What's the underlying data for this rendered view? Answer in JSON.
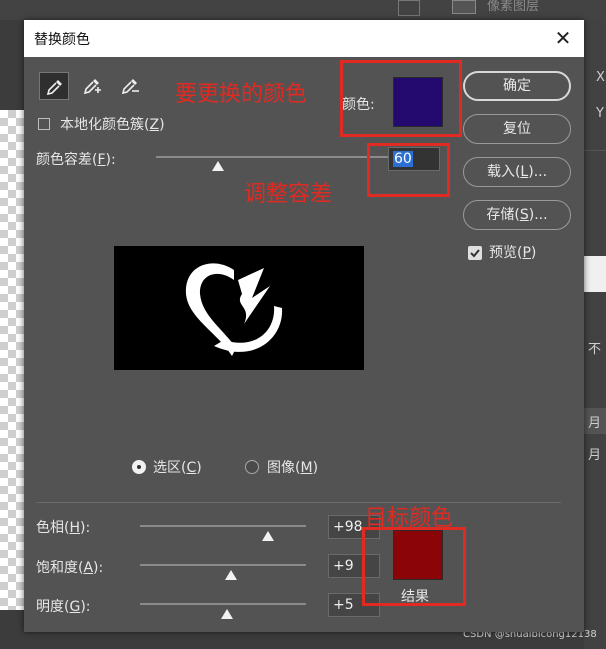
{
  "background": {
    "layer_label": "像素图层",
    "right_x": "X",
    "right_y": "Y",
    "right_items": [
      "不",
      "月",
      "月"
    ],
    "watermark": "CSDN @shuaibicong12138"
  },
  "dialog": {
    "title": "替换颜色",
    "close_glyph": "✕",
    "eyedropper_tools": [
      {
        "name": "eyedropper-icon",
        "active": true
      },
      {
        "name": "eyedropper-plus-icon",
        "active": false
      },
      {
        "name": "eyedropper-minus-icon",
        "active": false
      }
    ],
    "localized_clusters": {
      "label": "本地化颜色簇(",
      "key": "Z",
      "suffix": ")",
      "checked": false
    },
    "fuzziness": {
      "label": "颜色容差(",
      "key": "F",
      "suffix": "):",
      "value": "60"
    },
    "color_label": "颜色:",
    "source_color": "#24096e",
    "buttons": {
      "ok": "确定",
      "reset": "复位",
      "load": {
        "label": "载入(",
        "key": "L",
        "suffix": ")..."
      },
      "save": {
        "label": "存储(",
        "key": "S",
        "suffix": ")..."
      }
    },
    "preview": {
      "label": "预览(",
      "key": "P",
      "suffix": ")",
      "checked": true
    },
    "view_mode": {
      "selection": {
        "label": "选区(",
        "key": "C",
        "suffix": ")",
        "selected": true
      },
      "image": {
        "label": "图像(",
        "key": "M",
        "suffix": ")",
        "selected": false
      }
    },
    "hue": {
      "label": "色相(",
      "key": "H",
      "suffix": "):",
      "value": "+98"
    },
    "saturation": {
      "label": "饱和度(",
      "key": "A",
      "suffix": "):",
      "value": "+9"
    },
    "lightness": {
      "label": "明度(",
      "key": "G",
      "suffix": "):",
      "value": "+5"
    },
    "result_label": "结果",
    "result_color": "#8a0408"
  },
  "annotations": {
    "color_to_replace": "要更换的颜色",
    "adjust_tolerance": "调整容差",
    "target_color": "目标颜色",
    "annotation_color": "#e02a22"
  }
}
